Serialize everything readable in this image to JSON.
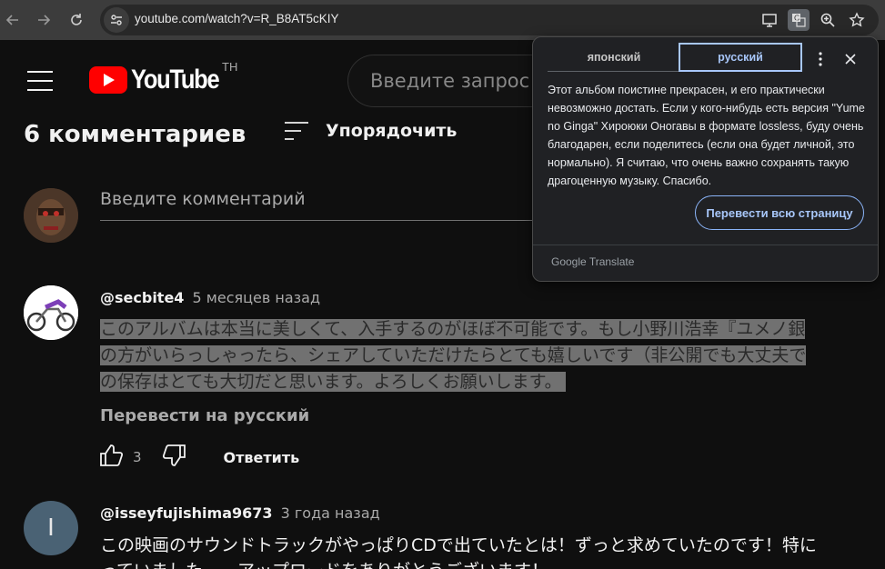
{
  "browser": {
    "url": "youtube.com/watch?v=R_B8AT5cKIY"
  },
  "header": {
    "logo_text": "YouTube",
    "region": "TH",
    "search_placeholder": "Введите запрос"
  },
  "comments": {
    "count_label": "6 комментариев",
    "sort_label": "Упорядочить",
    "add_placeholder": "Введите комментарий",
    "items": [
      {
        "author": "@secbite4",
        "time": "5 месяцев назад",
        "lines": [
          "このアルバムは本当に美しくて、入手するのがほぼ不可能です。もし小野川浩幸『ユメノ銀",
          "の方がいらっしゃったら、シェアしていただけたらとても嬉しいです（非公開でも大丈夫で",
          "の保存はとても大切だと思います。よろしくお願いします。"
        ],
        "translate_link": "Перевести на русский",
        "likes": "3",
        "reply_label": "Ответить"
      },
      {
        "author": "@isseyfujishima9673",
        "time": "3 года назад",
        "avatar_letter": "I",
        "lines": [
          "この映画のサウンドトラックがやっぱりCDで出ていたとは！ずっと求めていたのです！特に",
          "っていました……アップロードをありがとうございます！"
        ]
      }
    ]
  },
  "translate_popup": {
    "source_lang": "японский",
    "target_lang": "русский",
    "text": "Этот альбом поистине прекрасен, и его практически невозможно достать. Если у кого-нибудь есть версия \"Yume no Ginga\" Хироюки Оногавы в формате lossless, буду очень благодарен, если поделитесь (если она будет личной, это нормально). Я считаю, что очень важно сохранять такую драгоценную музыку. Спасибо.",
    "button": "Перевести всю страницу",
    "brand": "Google Translate"
  },
  "colors": {
    "brand_red": "#ff0000",
    "accent_blue": "#a8c7fa",
    "highlight": "#717171"
  }
}
